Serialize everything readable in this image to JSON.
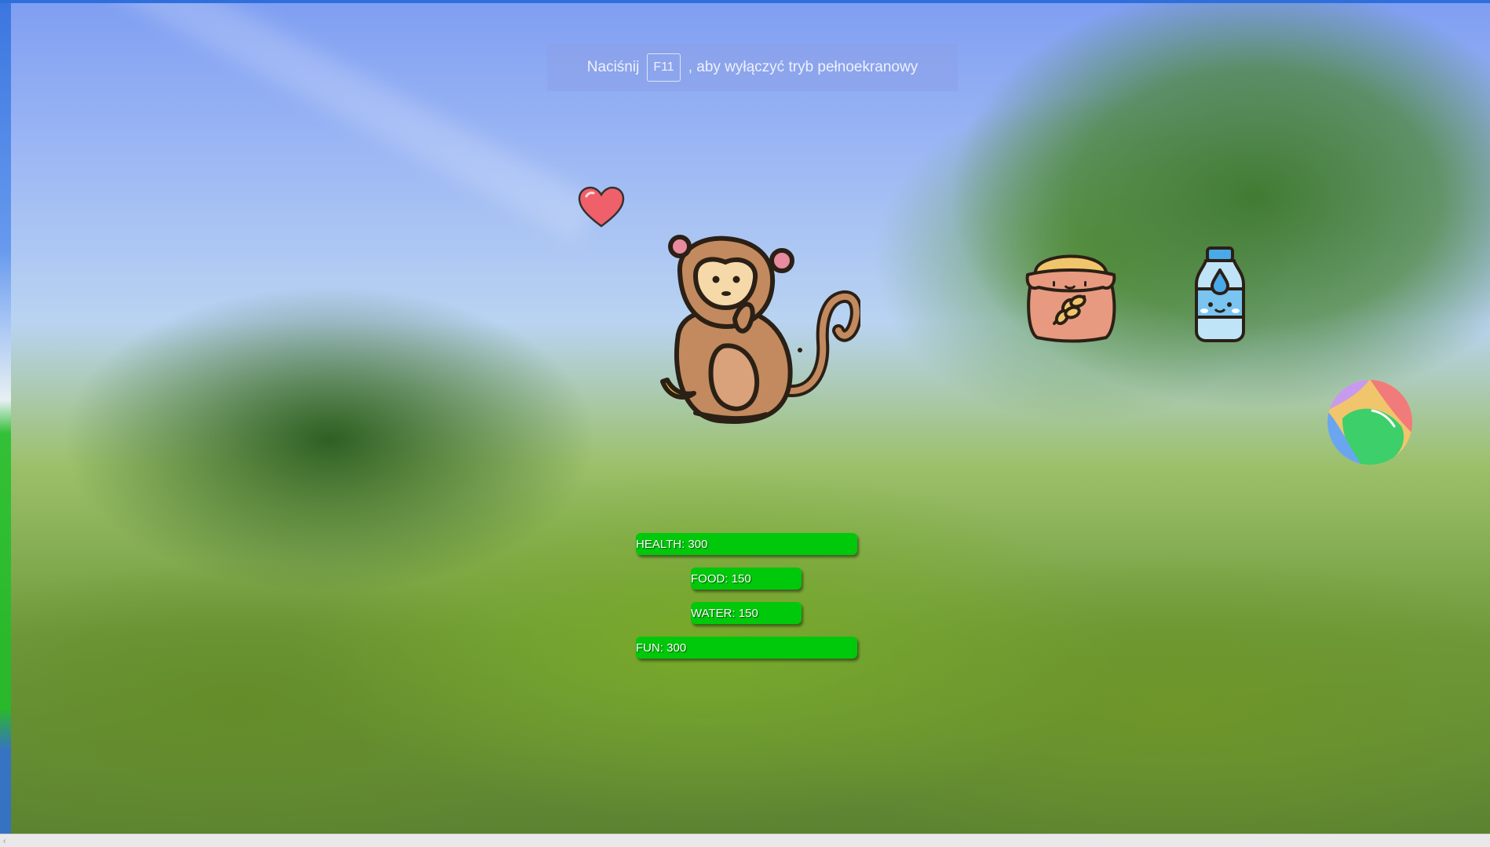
{
  "hint": {
    "prefix": "Naciśnij",
    "key": "F11",
    "suffix": ", aby wyłączyć tryb pełnoekranowy"
  },
  "icons": {
    "heart": "heart-icon",
    "monkey": "monkey-icon",
    "food": "food-sack-icon",
    "water": "water-bottle-icon",
    "ball": "beach-ball-icon"
  },
  "stats": {
    "health": "HEALTH: 300",
    "food": "FOOD: 150",
    "water": "WATER: 150",
    "fun": "FUN: 300"
  },
  "colors": {
    "bar": "#00c80a",
    "heart": "#f0606a"
  },
  "scrollbar": {
    "left_arrow": "‹"
  }
}
